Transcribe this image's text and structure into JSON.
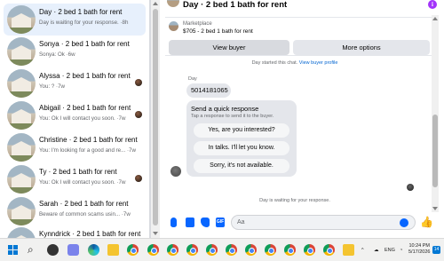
{
  "conversations": [
    {
      "title": "Day · 2 bed 1 bath for rent",
      "subtitle": "Day is waiting for your response. ·8h",
      "active": true
    },
    {
      "title": "Sonya · 2 bed 1 bath for rent",
      "subtitle": "Sonya: Ok ·6w"
    },
    {
      "title": "Alyssa · 2 bed 1 bath for rent",
      "subtitle": "You: ? ·7w"
    },
    {
      "title": "Abigail · 2 bed 1 bath for rent",
      "subtitle": "You: Ok I will contact you soon. ·7w"
    },
    {
      "title": "Christine · 2 bed 1 bath for rent",
      "subtitle": "You: I'm looking for a good and re... ·7w"
    },
    {
      "title": "Ty · 2 bed 1 bath for rent",
      "subtitle": "You: Ok I will contact you soon. ·7w"
    },
    {
      "title": "Sarah · 2 bed 1 bath for rent",
      "subtitle": "Beware of common scams usin... ·7w"
    },
    {
      "title": "Kynndrick · 2 bed 1 bath for rent",
      "subtitle": ""
    }
  ],
  "chat": {
    "title": "Day · 2 bed 1 bath for rent",
    "info_icon": "info-icon",
    "listing": {
      "marketplace": "Marketplace",
      "price_title": "$705 - 2 bed 1 bath for rent",
      "view_buyer": "View buyer",
      "more_options": "More options"
    },
    "started_text": "Day started this chat.",
    "started_link": "View buyer profile",
    "sender_name": "Day",
    "phone_message": "5014181065",
    "quick_response": {
      "title": "Send a quick response",
      "subtitle": "Tap a response to send it to the buyer.",
      "options": [
        "Yes, are you interested?",
        "In talks. I'll let you know.",
        "Sorry, it's not available."
      ]
    },
    "waiting_text": "Day is waiting for your response."
  },
  "composer": {
    "placeholder": "Aa",
    "gif_label": "GIF",
    "like_icon": "👍"
  },
  "taskbar": {
    "lang": "ENG",
    "time": "10:24 PM",
    "date": "5/17/2026",
    "notification_count": "14"
  },
  "colors": {
    "accent": "#0866ff",
    "active_row": "#e7f0fc",
    "info": "#a334fa"
  }
}
